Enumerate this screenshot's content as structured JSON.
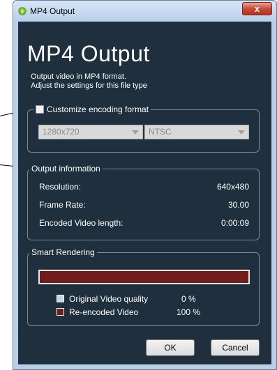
{
  "window": {
    "title": "MP4 Output",
    "close_glyph": "x"
  },
  "header": {
    "title": "MP4 Output",
    "description_line1": "Output video in MP4 format.",
    "description_line2": "Adjust the settings for this file type"
  },
  "encoding": {
    "checkbox_label": "Customize encoding format",
    "checked": false,
    "resolution_value": "1280x720",
    "standard_value": "NTSC"
  },
  "output_info": {
    "legend": "Output information",
    "rows": [
      {
        "label": "Resolution:",
        "value": "640x480"
      },
      {
        "label": "Frame Rate:",
        "value": "30.00"
      },
      {
        "label": "Encoded Video length:",
        "value": "0:00:09"
      }
    ]
  },
  "smart_rendering": {
    "legend": "Smart Rendering",
    "reencoded_fraction": 1.0,
    "items": [
      {
        "label": "Original Video quality",
        "percent": "0 %",
        "color": "#c8d2e6"
      },
      {
        "label": "Re-encoded Video",
        "percent": "100 %",
        "color": "#6e1c1c"
      }
    ]
  },
  "buttons": {
    "ok": "OK",
    "cancel": "Cancel"
  }
}
